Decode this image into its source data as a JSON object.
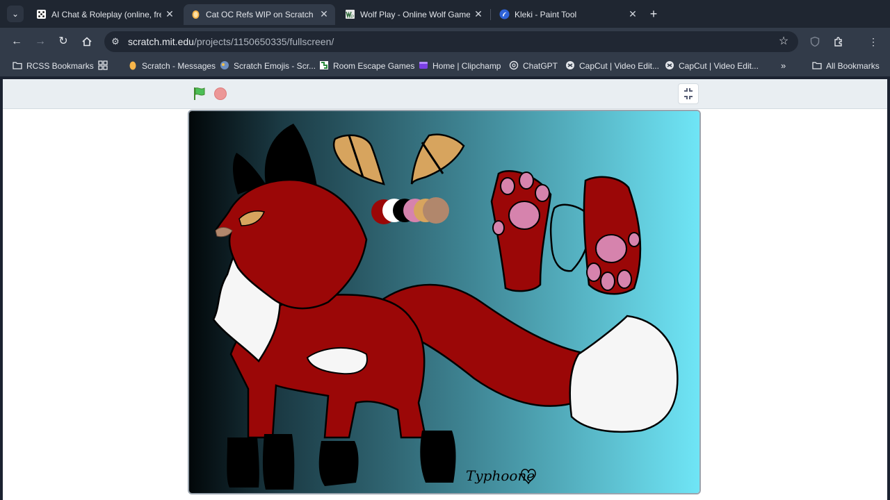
{
  "tabs": [
    {
      "title": "AI Chat & Roleplay (online, free",
      "active": false,
      "icon": "dice-icon"
    },
    {
      "title": "Cat OC Refs WIP on Scratch",
      "active": true,
      "icon": "scratch-cat-icon"
    },
    {
      "title": "Wolf Play - Online Wolf Game!",
      "active": false,
      "icon": "wolf-play-icon"
    },
    {
      "title": "Kleki - Paint Tool",
      "active": false,
      "icon": "kleki-icon"
    }
  ],
  "toolbar": {
    "url_host": "scratch.mit.edu",
    "url_path": "/projects/1150650335/fullscreen/"
  },
  "bookmarks": [
    {
      "label": "RCSS Bookmarks",
      "icon": "folder-icon"
    },
    {
      "label": "Scratch - Messages",
      "icon": "scratch-cat-icon"
    },
    {
      "label": "Scratch Emojis - Scr...",
      "icon": "globe-icon"
    },
    {
      "label": "Room Escape Games",
      "icon": "puzzle-icon"
    },
    {
      "label": "Home | Clipchamp",
      "icon": "clipchamp-icon"
    },
    {
      "label": "ChatGPT",
      "icon": "openai-icon"
    },
    {
      "label": "CapCut | Video Edit...",
      "icon": "capcut-icon"
    },
    {
      "label": "CapCut | Video Edit...",
      "icon": "capcut-icon"
    }
  ],
  "all_bookmarks_label": "All Bookmarks",
  "stage": {
    "signature": "Typhoone",
    "palette": [
      "#9b0707",
      "#ffffff",
      "#000000",
      "#d683ad",
      "#d7a45e",
      "#b1876c"
    ]
  }
}
